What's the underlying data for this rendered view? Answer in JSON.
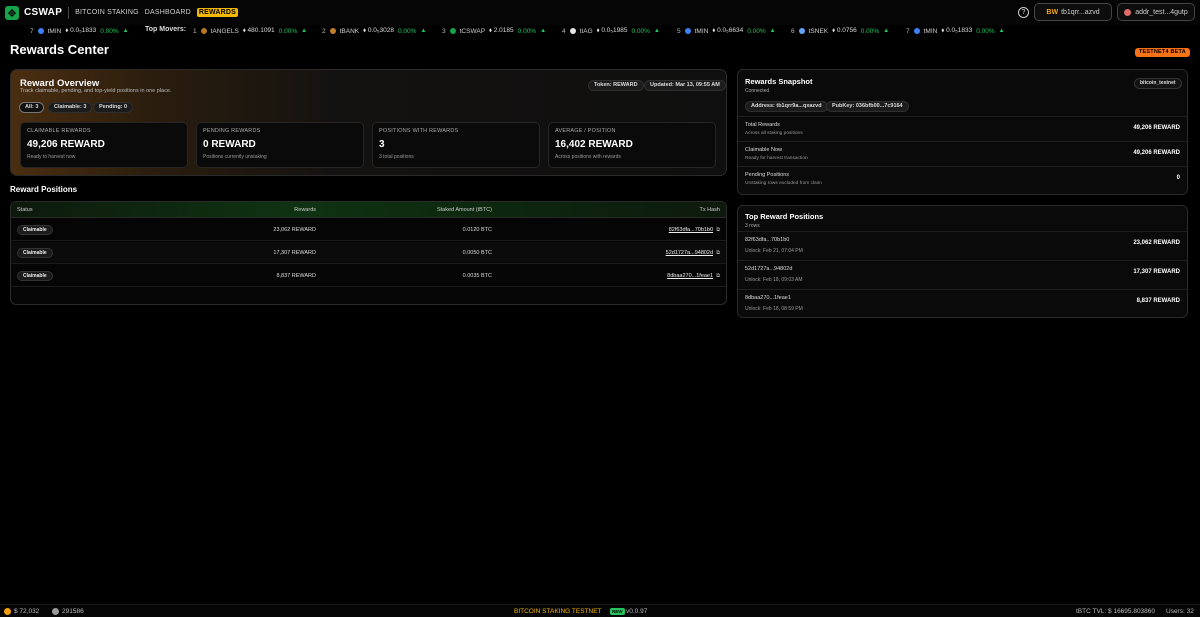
{
  "nav": {
    "brand": "CSWAP",
    "links": [
      "BITCOIN STAKING",
      "DASHBOARD",
      "REWARDS"
    ],
    "help": "?",
    "wallet_btc_prefix": "BW",
    "wallet_btc": "tb1qrr...azvd",
    "wallet_ordi": "addr_test...4gutp"
  },
  "ticker": {
    "movers_label": "Top Movers:",
    "items": [
      {
        "rank": "7",
        "name": "tMIN",
        "price": "0.0₅1833",
        "change": "0.00%",
        "icon_color": "#3b82f6"
      },
      {
        "rank": "1",
        "name": "tANGELS",
        "price": "480.1091",
        "change": "0.00%",
        "icon_color": "#b7791f"
      },
      {
        "rank": "2",
        "name": "tBANK",
        "price": "0.0₅3028",
        "change": "0.00%",
        "icon_color": "#c47f2c"
      },
      {
        "rank": "3",
        "name": "tCSWAP",
        "price": "2.0185",
        "change": "0.00%",
        "icon_color": "#17a34a"
      },
      {
        "rank": "4",
        "name": "tIAG",
        "price": "0.0₅1985",
        "change": "0.00%",
        "icon_color": "#e5e5e5"
      },
      {
        "rank": "5",
        "name": "tMIN",
        "price": "0.0₅6634",
        "change": "0.00%",
        "icon_color": "#3b82f6"
      },
      {
        "rank": "6",
        "name": "tSNEK",
        "price": "0.0756",
        "change": "0.00%",
        "icon_color": "#60a5fa"
      },
      {
        "rank": "7",
        "name": "tMIN",
        "price": "0.0₅1833",
        "change": "0.00%",
        "icon_color": "#3b82f6"
      }
    ]
  },
  "page": {
    "title": "Rewards Center",
    "badge": "TESTNET4 BETA"
  },
  "overview": {
    "title": "Reward Overview",
    "subtitle": "Track claimable, pending, and top-yield positions in one place.",
    "token": "Token: REWARD",
    "updated": "Updated: Mar 13, 09:55 AM",
    "filters": [
      "All: 3",
      "Claimable: 3",
      "Pending: 0"
    ],
    "stats": [
      {
        "label": "Claimable Rewards",
        "value": "49,206 REWARD",
        "sub": "Ready to harvest now"
      },
      {
        "label": "Pending Rewards",
        "value": "0 REWARD",
        "sub": "Positions currently unstaking"
      },
      {
        "label": "Positions With Rewards",
        "value": "3",
        "sub": "3 total positions"
      },
      {
        "label": "Average / Position",
        "value": "16,402 REWARD",
        "sub": "Across positions with rewards"
      }
    ]
  },
  "positions": {
    "title": "Reward Positions",
    "headers": [
      "Status",
      "Rewards",
      "Staked Amount (tBTC)",
      "Tx Hash"
    ],
    "rows": [
      {
        "status": "Claimable",
        "rewards": "23,062 REWARD",
        "staked": "0.0120 BTC",
        "hash": "82f63dfa...70b1b0"
      },
      {
        "status": "Claimable",
        "rewards": "17,307 REWARD",
        "staked": "0.0050 BTC",
        "hash": "52d1727a...94802d"
      },
      {
        "status": "Claimable",
        "rewards": "8,837 REWARD",
        "staked": "0.0035 BTC",
        "hash": "8dbaa270...1feae1"
      }
    ]
  },
  "snapshot": {
    "title": "Rewards Snapshot",
    "status": "Connected",
    "network": "bitcoin_testnet",
    "address": "Address: tb1qrr9a...qxazvd",
    "pubkey": "PubKey: 036bfb00...7c9164",
    "rows": [
      {
        "label": "Total Rewards",
        "desc": "Across all staking positions",
        "value": "49,206 REWARD"
      },
      {
        "label": "Claimable Now",
        "desc": "Ready for harvest transaction",
        "value": "49,206 REWARD"
      },
      {
        "label": "Pending Positions",
        "desc": "Unstaking rows excluded from claim",
        "value": "0"
      }
    ]
  },
  "top_positions": {
    "title": "Top Reward Positions",
    "count": "3 rows",
    "rows": [
      {
        "hash": "82f63dfa...70b1b0",
        "unlock": "Unlock: Feb 21, 07:04 PM",
        "value": "23,062 REWARD"
      },
      {
        "hash": "52d1727a...94802d",
        "unlock": "Unlock: Feb 18, 09:03 AM",
        "value": "17,307 REWARD"
      },
      {
        "hash": "8dbaa270...1feae1",
        "unlock": "Unlock: Feb 18, 08:59 PM",
        "value": "8,837 REWARD"
      }
    ]
  },
  "footer": {
    "btc_price": "$ 72,032",
    "block": "291586",
    "network_label": "BITCOIN STAKING TESTNET",
    "new_badge": "NEW",
    "version": "v0.0.97",
    "tvl": "tBTC TVL: $ 16695.803860",
    "users": "Users: 32"
  },
  "colors": {
    "accent_yellow": "#f5b800",
    "beta_orange": "#f97316",
    "positive_green": "#22c55e",
    "brand_green": "#17a34a"
  }
}
